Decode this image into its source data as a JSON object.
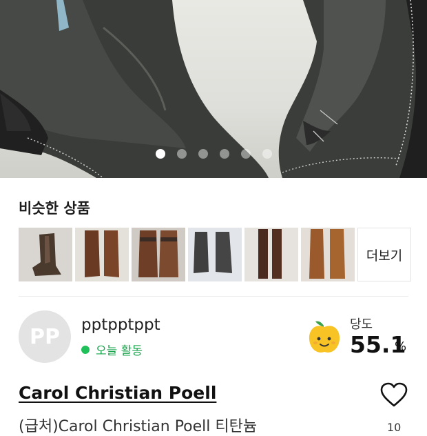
{
  "gallery": {
    "image_alt": "worn black leather boots",
    "page_count": 6,
    "active_index": 0
  },
  "similar": {
    "title": "비슷한 상품",
    "more_label": "더보기",
    "items": [
      {
        "name": "brown lace boot"
      },
      {
        "name": "brown tall boot"
      },
      {
        "name": "brown belted boot"
      },
      {
        "name": "grey lace-up boot"
      },
      {
        "name": "dark brown tall boot"
      },
      {
        "name": "tan tall boot"
      }
    ]
  },
  "seller": {
    "initials": "PP",
    "name": "pptpptppt",
    "activity": "오늘 활동",
    "sweetness_label": "당도",
    "sweetness_value": "55.1",
    "sweetness_unit": "%"
  },
  "product": {
    "brand": "Carol Christian Poell",
    "subtitle": "(급처)Carol Christian Poell 티탄늄",
    "like_count": "10"
  },
  "colors": {
    "active_green": "#1fc05a",
    "text_dark": "#111111"
  }
}
